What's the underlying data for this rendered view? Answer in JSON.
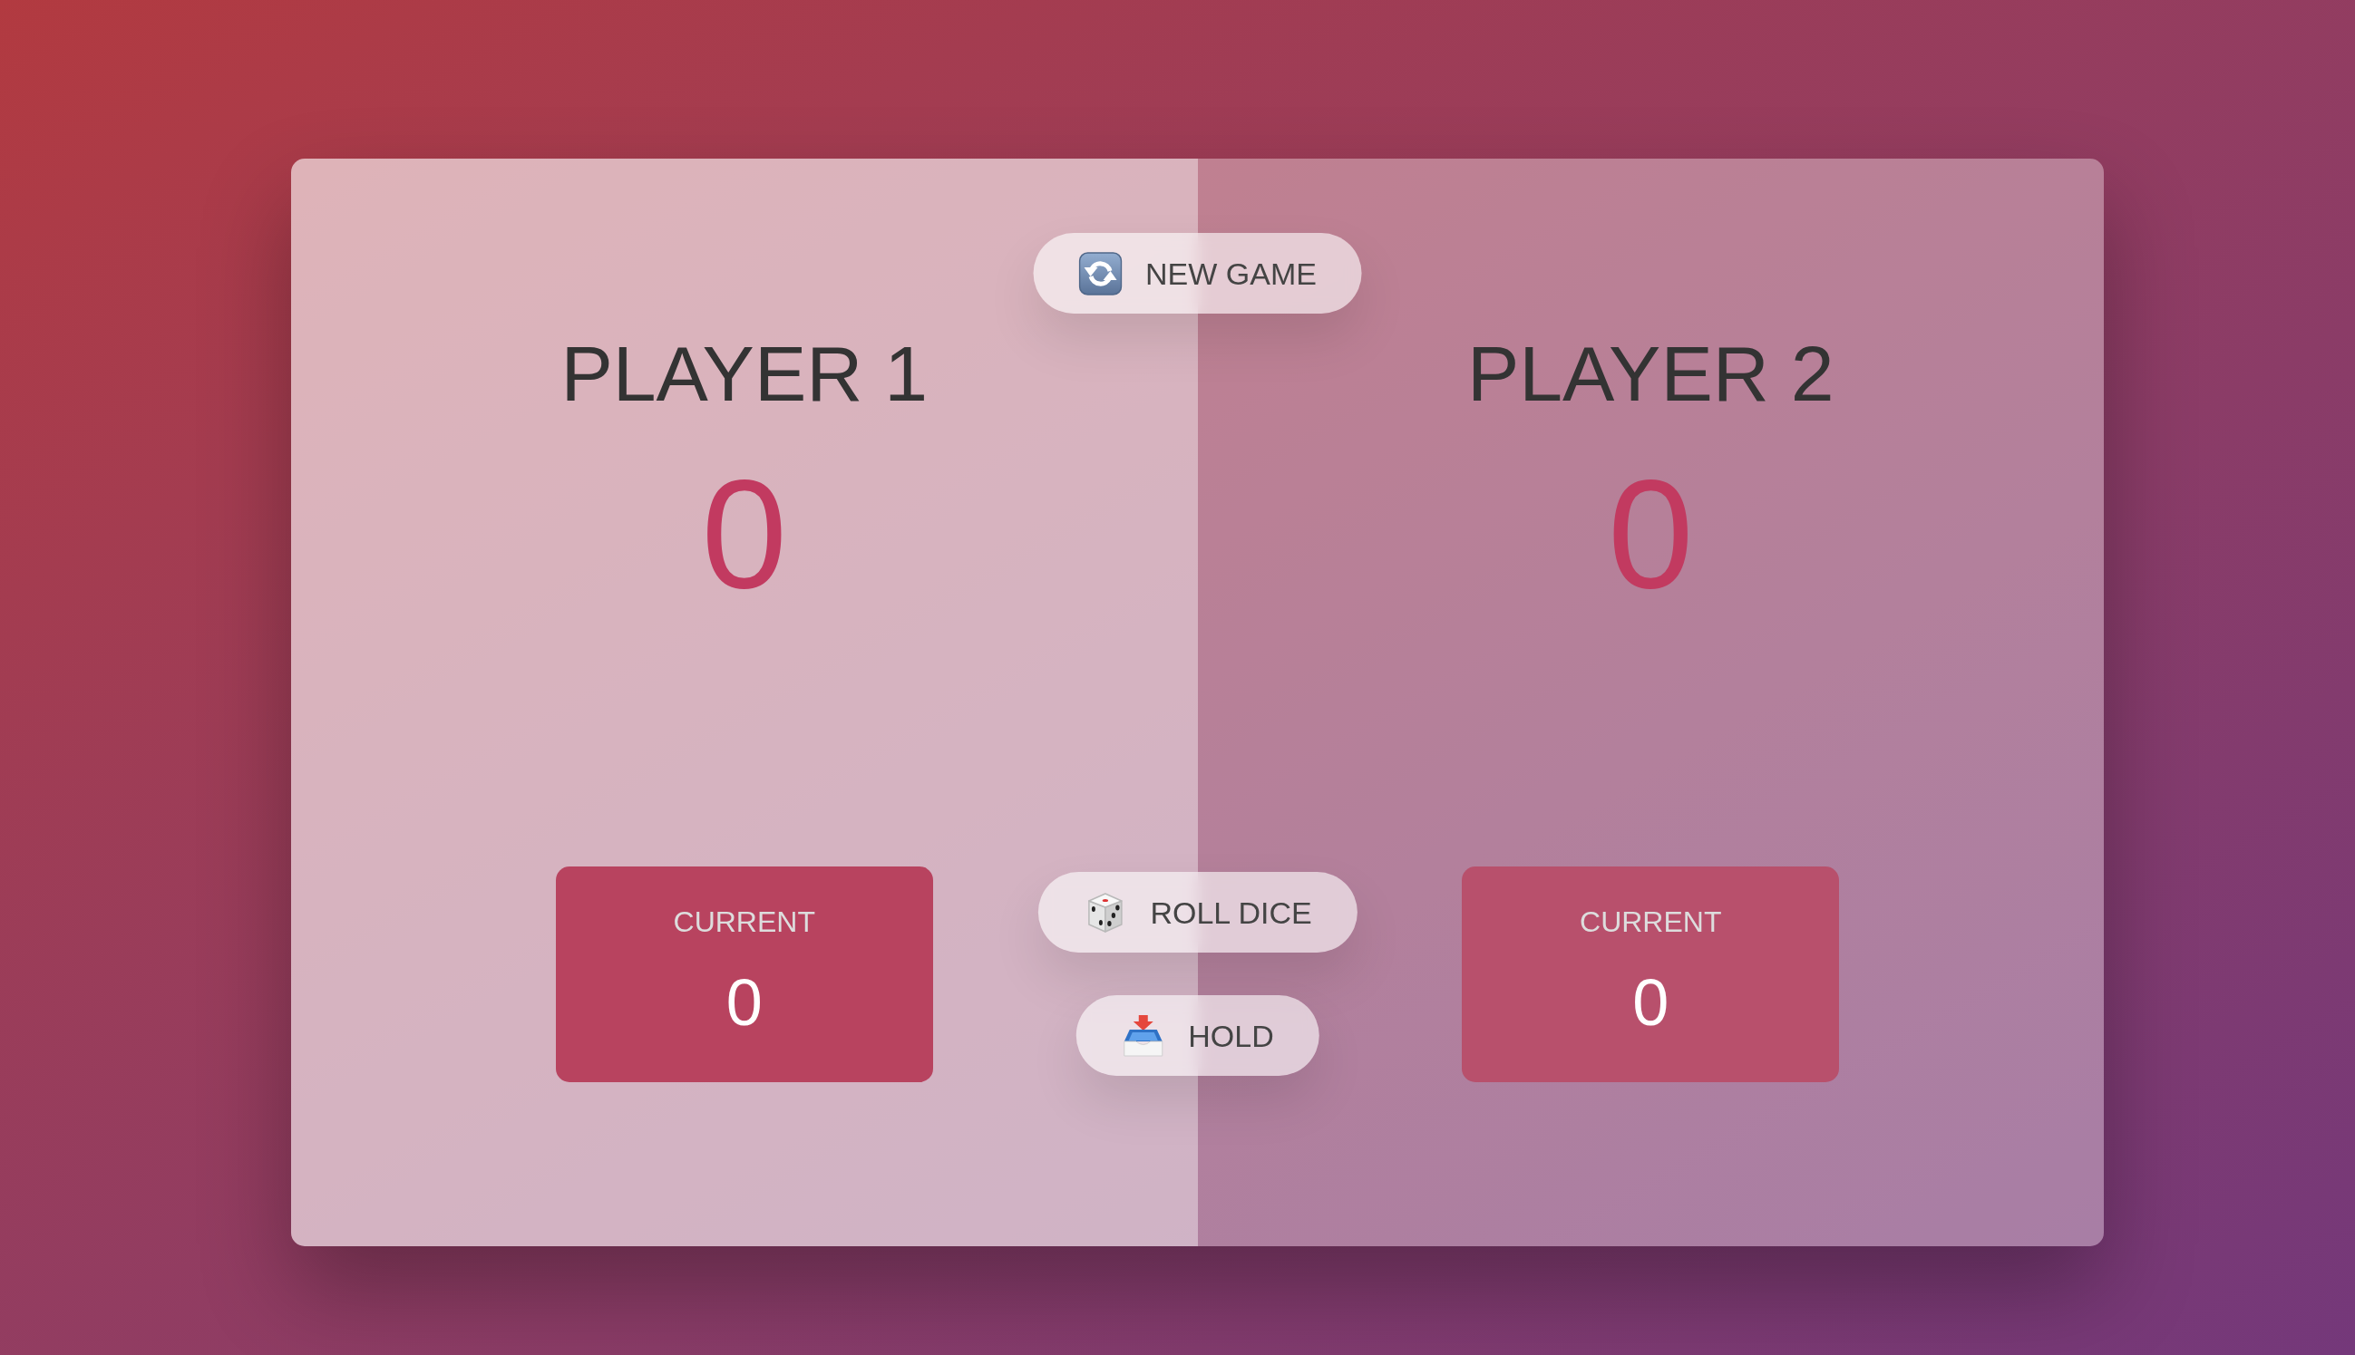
{
  "players": [
    {
      "name": "PLAYER 1",
      "score": "0",
      "current_label": "CURRENT",
      "current_score": "0",
      "active": true
    },
    {
      "name": "PLAYER 2",
      "score": "0",
      "current_label": "CURRENT",
      "current_score": "0",
      "active": false
    }
  ],
  "buttons": [
    {
      "kind": "new",
      "label": "NEW GAME"
    },
    {
      "kind": "roll",
      "label": "ROLL DICE"
    },
    {
      "kind": "hold",
      "label": "HOLD"
    }
  ]
}
